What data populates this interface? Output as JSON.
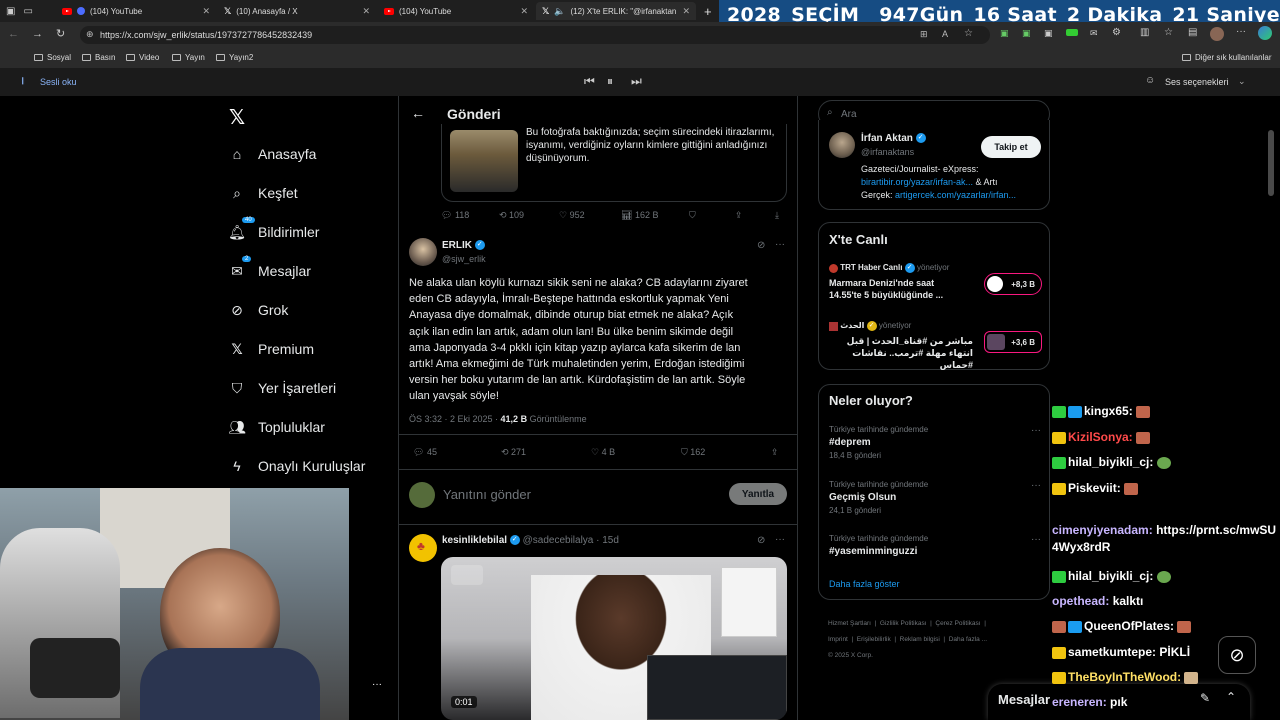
{
  "browser": {
    "tabs": [
      {
        "title": "(104) YouTube",
        "type": "yt"
      },
      {
        "title": "(10) Anasayfa / X",
        "type": "x"
      },
      {
        "title": "(104) YouTube",
        "type": "yt"
      },
      {
        "title": "(12) X'te ERLIK: \"@irfanaktan",
        "type": "x"
      }
    ],
    "url": "https://x.com/sjw_erlik/status/1973727786452832439",
    "bookmarks": [
      "Sosyal",
      "Basın",
      "Video",
      "Yayın",
      "Yayın2"
    ],
    "other_bookmarks": "Diğer sık kullanılanlar",
    "read_aloud": "Sesli oku",
    "voice_options": "Ses seçenekleri"
  },
  "countdown": {
    "year": "2028",
    "label": "SEÇİM",
    "days": "947",
    "days_label": "Gün",
    "hours": "16",
    "hours_label": "Saat",
    "minutes": "2",
    "minutes_label": "Dakika",
    "seconds": "21",
    "seconds_label": "Saniye"
  },
  "nav": {
    "items": [
      {
        "label": "Anasayfa",
        "icon": "home-icon"
      },
      {
        "label": "Keşfet",
        "icon": "search-icon"
      },
      {
        "label": "Bildirimler",
        "icon": "bell-icon",
        "badge": "40"
      },
      {
        "label": "Mesajlar",
        "icon": "mail-icon",
        "badge": "2"
      },
      {
        "label": "Grok",
        "icon": "grok-icon"
      },
      {
        "label": "Premium",
        "icon": "x-icon"
      },
      {
        "label": "Yer İşaretleri",
        "icon": "bookmark-icon"
      },
      {
        "label": "Topluluklar",
        "icon": "people-icon"
      },
      {
        "label": "Onaylı Kuruluşlar",
        "icon": "lightning-icon"
      }
    ]
  },
  "main": {
    "header": "Gönderi",
    "quoted_text": "Bu fotoğrafa baktığınızda; seçim sürecindeki itirazlarımı, isyanımı, verdiğiniz oyların kimlere gittiğini anladığınızı düşünüyorum.",
    "parent_stats": {
      "replies": "118",
      "retweets": "109",
      "likes": "952",
      "views": "162 B"
    },
    "tweet": {
      "name": "ERLIK",
      "handle": "@sjw_erlik",
      "text": "Ne alaka ulan köylü kurnazı sikik seni ne alaka? CB adaylarını ziyaret eden CB adayıyla, İmralı-Beştepe hattında eskortluk yapmak Yeni Anayasa diye domalmak, dibinde oturup biat etmek ne alaka? Açık açık ilan edin lan artık, adam olun lan! Bu ülke benim sikimde değil ama Japonyada 3-4 pkklı için kitap yazıp aylarca kafa sikerim de lan artık! Ama ekmeğimi de Türk muhaletinden yerim, Erdoğan istediğimi versin her boku yutarım de lan artık. Kürdofaşistim de lan artık. Söyle ulan yavşak söyle!",
      "time": "ÖS 3:32 · 2 Eki 2025 · ",
      "views": "41,2 B",
      "views_label": " Görüntülenme",
      "replies": "45",
      "retweets": "271",
      "likes": "4 B",
      "bookmarks": "162"
    },
    "reply_placeholder": "Yanıtını gönder",
    "reply_button": "Yanıtla",
    "reply": {
      "name": "kesinliklebilal",
      "handle": "@sadecebilalya · 15d",
      "video_time": "0:01"
    }
  },
  "sidebar": {
    "search_placeholder": "Ara",
    "profile": {
      "name": "İrfan Aktan",
      "handle": "@irfanaktans",
      "follow": "Takip et",
      "bio1": "Gazeteci/Journalist- eXpress:",
      "bio_link1": "birartibir.org/yazar/irfan-ak...",
      "bio2": " & Artı",
      "bio3": "Gerçek: ",
      "bio_link2": "artigercek.com/yazarlar/irfan..."
    },
    "live_title": "X'te Canlı",
    "live": [
      {
        "source": "TRT Haber Canlı",
        "status": "yönetiyor",
        "title": "Marmara Denizi'nde saat 14.55'te 5 büyüklüğünde ...",
        "count": "+8,3 B"
      },
      {
        "source": "الحدث",
        "status": "yönetiyor",
        "title": "مباشر من #قناة_الحدث | قبل انتهاء مهلة #ترمب.. نقاشات #حماس",
        "count": "+3,6 B"
      }
    ],
    "trends_title": "Neler oluyor?",
    "trends": [
      {
        "context": "Türkiye tarihinde gündemde",
        "tag": "#deprem",
        "count": "18,4 B gönderi"
      },
      {
        "context": "Türkiye tarihinde gündemde",
        "tag": "Geçmiş Olsun",
        "count": "24,1 B gönderi"
      },
      {
        "context": "Türkiye tarihinde gündemde",
        "tag": "#yaseminminguzzi",
        "count": ""
      }
    ],
    "show_more": "Daha fazla göster",
    "footer": [
      "Hizmet Şartları",
      "Gizlilik Politikası",
      "Çerez Politikası",
      "Imprint",
      "Erişilebilirlik",
      "Reklam bilgisi",
      "Daha fazla ...",
      "© 2025 X Corp."
    ],
    "messages": "Mesajlar"
  },
  "chat": [
    {
      "user": "kingx65:",
      "msg": "",
      "color": "#ffffff"
    },
    {
      "user": "KizilSonya:",
      "msg": "",
      "color": "#ff4a4a"
    },
    {
      "user": "hilal_biyikli_cj:",
      "msg": "",
      "color": "#ffffff"
    },
    {
      "user": "Piskeviit:",
      "msg": "",
      "color": "#ffffff"
    },
    {
      "user": "cimenyiyenadam:",
      "msg": "https://prnt.sc/mwSU4Wyx8rdR",
      "color": "#c8b6ff"
    },
    {
      "user": "hilal_biyikli_cj:",
      "msg": "",
      "color": "#ffffff"
    },
    {
      "user": "opethead:",
      "msg": "kalktı",
      "color": "#c8b6ff"
    },
    {
      "user": "QueenOfPlates:",
      "msg": "",
      "color": "#ffffff"
    },
    {
      "user": "sametkumtepe:",
      "msg": "PİKLİ",
      "color": "#ffffff"
    },
    {
      "user": "TheBoyInTheWood:",
      "msg": "",
      "color": "#ffe066"
    },
    {
      "user": "ereneren:",
      "msg": "pık",
      "color": "#c8b6ff"
    }
  ]
}
